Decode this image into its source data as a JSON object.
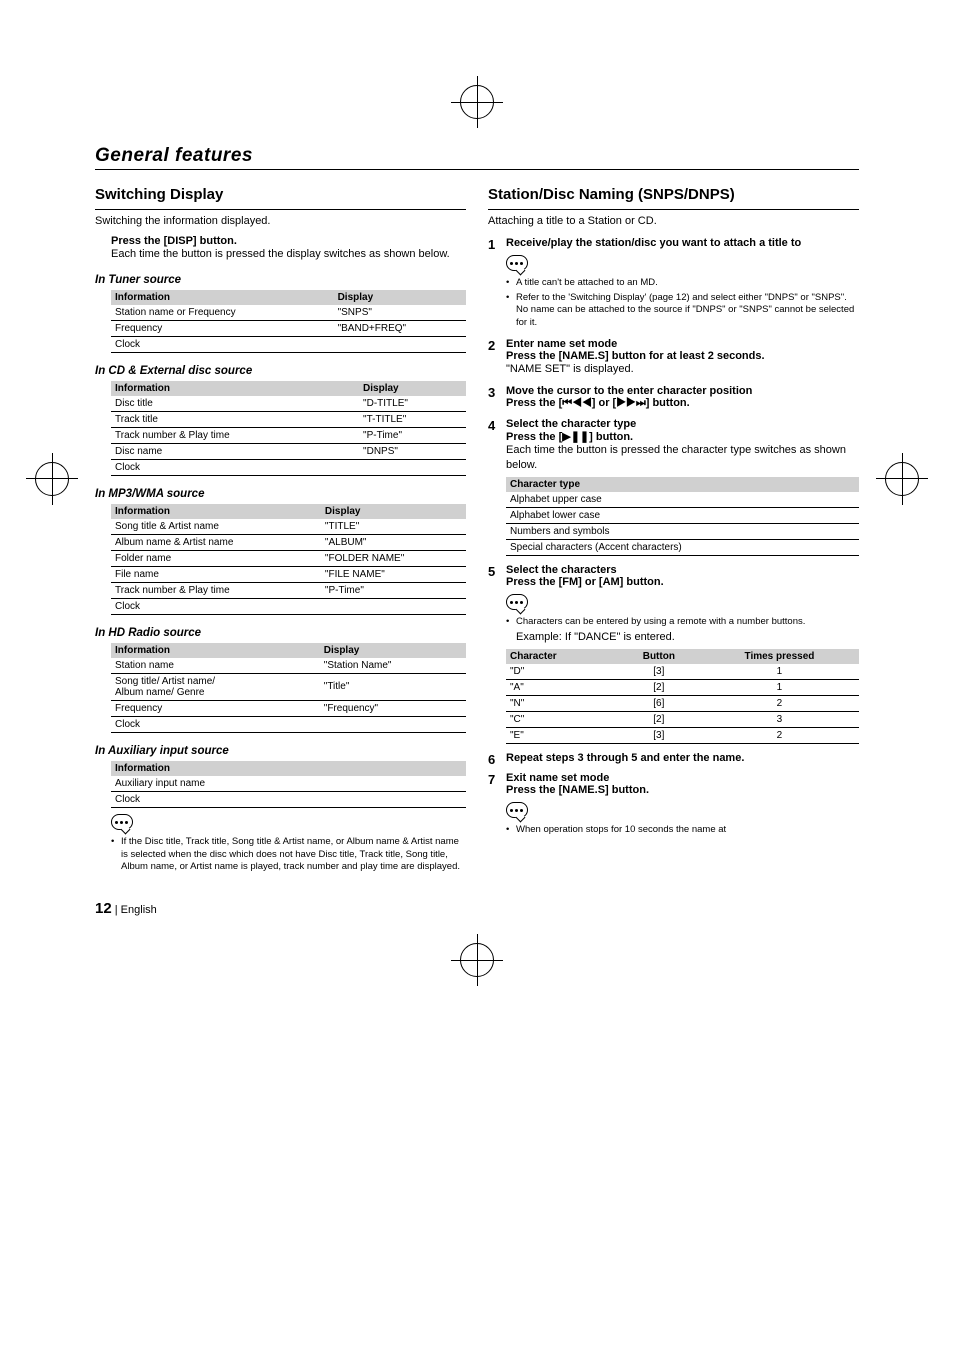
{
  "header": {
    "title": "General features"
  },
  "left": {
    "section_title": "Switching Display",
    "intro": "Switching the information displayed.",
    "press": "Press the [DISP] button.",
    "press_body": "Each time the button is pressed the display switches as shown below.",
    "tuner": {
      "heading": "In Tuner source",
      "col1": "Information",
      "col2": "Display",
      "rows": [
        {
          "a": "Station name or Frequency",
          "b": "\"SNPS\""
        },
        {
          "a": "Frequency",
          "b": "\"BAND+FREQ\""
        },
        {
          "a": "Clock",
          "b": ""
        }
      ]
    },
    "cd": {
      "heading": "In CD & External disc source",
      "rows": [
        {
          "a": "Disc title",
          "b": "\"D-TITLE\""
        },
        {
          "a": "Track title",
          "b": "\"T-TITLE\""
        },
        {
          "a": "Track number & Play time",
          "b": "\"P-Time\""
        },
        {
          "a": "Disc name",
          "b": "\"DNPS\""
        },
        {
          "a": "Clock",
          "b": ""
        }
      ]
    },
    "mp3": {
      "heading": "In MP3/WMA source",
      "rows": [
        {
          "a": "Song title & Artist name",
          "b": "\"TITLE\""
        },
        {
          "a": "Album name & Artist name",
          "b": "\"ALBUM\""
        },
        {
          "a": "Folder name",
          "b": "\"FOLDER NAME\""
        },
        {
          "a": "File name",
          "b": "\"FILE NAME\""
        },
        {
          "a": "Track number & Play time",
          "b": "\"P-Time\""
        },
        {
          "a": "Clock",
          "b": ""
        }
      ]
    },
    "hd": {
      "heading": "In HD Radio source",
      "rows": [
        {
          "a": "Station name",
          "b": "\"Station Name\""
        },
        {
          "a": "Song title/ Artist name/\nAlbum name/ Genre",
          "b": "\"Title\""
        },
        {
          "a": "Frequency",
          "b": "\"Frequency\""
        },
        {
          "a": "Clock",
          "b": ""
        }
      ]
    },
    "aux": {
      "heading": "In Auxiliary input source",
      "col1": "Information",
      "rows": [
        {
          "a": "Auxiliary input name"
        },
        {
          "a": "Clock"
        }
      ]
    },
    "note": "If the Disc title, Track title, Song title & Artist name, or Album name & Artist name is selected when the disc which does not have Disc title, Track title, Song title, Album name, or Artist name is played, track number and play time are displayed."
  },
  "right": {
    "section_title": "Station/Disc Naming (SNPS/DNPS)",
    "intro": "Attaching a title to a Station or CD.",
    "s1": {
      "title": "Receive/play the station/disc you want to attach a title to",
      "n1": "A title can't be attached to an MD.",
      "n2": "Refer to the 'Switching Display' (page 12) and select either \"DNPS\" or \"SNPS\". No name can be attached to the source if \"DNPS\" or \"SNPS\" cannot be selected for it."
    },
    "s2": {
      "title": "Enter name set mode",
      "press": "Press the [NAME.S] button for at least 2 seconds.",
      "body": "\"NAME SET\" is displayed."
    },
    "s3": {
      "title": "Move the cursor to the enter character position",
      "press": "Press the [⏮◀◀] or [▶▶⏭] button."
    },
    "s4": {
      "title": "Select the character type",
      "press": "Press the [▶❚❚] button.",
      "body": "Each time the button is pressed the character type switches as shown below.",
      "th": "Character type",
      "rows": [
        "Alphabet upper case",
        "Alphabet lower case",
        "Numbers and symbols",
        "Special characters (Accent characters)"
      ]
    },
    "s5": {
      "title": "Select the characters",
      "press": "Press the [FM] or [AM] button.",
      "note": "Characters can be entered by using a remote with a number buttons.",
      "example": "Example: If \"DANCE\" is entered.",
      "th1": "Character",
      "th2": "Button",
      "th3": "Times pressed",
      "rows": [
        {
          "c": "\"D\"",
          "b": "[3]",
          "t": "1"
        },
        {
          "c": "\"A\"",
          "b": "[2]",
          "t": "1"
        },
        {
          "c": "\"N\"",
          "b": "[6]",
          "t": "2"
        },
        {
          "c": "\"C\"",
          "b": "[2]",
          "t": "3"
        },
        {
          "c": "\"E\"",
          "b": "[3]",
          "t": "2"
        }
      ]
    },
    "s6": {
      "title": "Repeat steps 3 through 5 and enter the name."
    },
    "s7": {
      "title": "Exit name set mode",
      "press": "Press the [NAME.S] button.",
      "note": "When operation stops for 10 seconds the name at"
    }
  },
  "footer": {
    "page": "12",
    "sep": "|",
    "lang": "English"
  }
}
